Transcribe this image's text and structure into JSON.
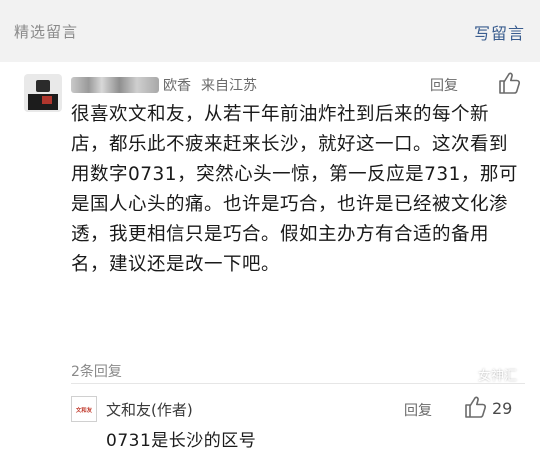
{
  "header": {
    "title": "精选留言",
    "write_button": "写留言"
  },
  "comment": {
    "user_name_visible": "欧香",
    "location": "来自江苏",
    "reply_label": "回复",
    "text": "很喜欢文和友，从若干年前油炸社到后来的每个新店，都乐此不疲来赶来长沙，就好这一口。这次看到用数字0731，突然心头一惊，第一反应是731，那可是国人心头的痛。也许是巧合，也许是已经被文化渗透，我更相信只是巧合。假如主办方有合适的备用名，建议还是改一下吧。",
    "reply_count": "2条回复"
  },
  "author_reply": {
    "avatar_text": "文和友",
    "name": "文和友(作者)",
    "reply_label": "回复",
    "like_count": "29",
    "text": "0731是长沙的区号"
  },
  "watermark": {
    "text": "女神汇"
  },
  "colors": {
    "header_bg": "#f2f2f2",
    "link_blue": "#3a5d8f",
    "meta_gray": "#6b6b6b"
  }
}
